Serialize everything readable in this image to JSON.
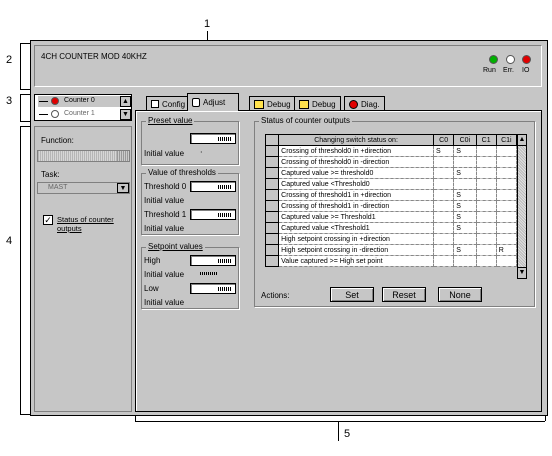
{
  "callouts": {
    "c1": "1",
    "c2": "2",
    "c3": "3",
    "c4": "4",
    "c5": "5"
  },
  "header": {
    "title": "4CH COUNTER MOD 40KHZ",
    "leds": [
      {
        "label": "Run",
        "color": "#00b000"
      },
      {
        "label": "Err.",
        "color": "#ffffff"
      },
      {
        "label": "IO",
        "color": "#e00000"
      }
    ]
  },
  "channels": [
    {
      "label": "Counter 0",
      "color": "#e00000"
    },
    {
      "label": "Counter 1",
      "color": "#ffffff"
    }
  ],
  "left": {
    "function_label": "Function:",
    "task_label": "Task:",
    "task_value": "MAST",
    "status_checkbox_label": "Status of counter outputs",
    "status_checked": true
  },
  "tabs": [
    {
      "label": "Config",
      "icon": "config-icon"
    },
    {
      "label": "Adjust",
      "icon": "adjust-icon"
    },
    {
      "label": "Debug",
      "icon": "debug-icon"
    },
    {
      "label": "Debug",
      "icon": "debug-icon"
    },
    {
      "label": "Diag.",
      "icon": "diag-icon"
    }
  ],
  "preset": {
    "title": "Preset value",
    "initial_label": "Initial value"
  },
  "thresholds": {
    "title": "Value of thresholds",
    "t0_label": "Threshold 0",
    "t1_label": "Threshold 1",
    "initial_label": "Initial value"
  },
  "setpoint": {
    "title": "Setpoint values",
    "high_label": "High",
    "low_label": "Low",
    "initial_label": "Initial value"
  },
  "outputs": {
    "title": "Status of counter outputs",
    "columns": [
      "Changing switch status on:",
      "C0",
      "C0i",
      "C1",
      "C1i"
    ],
    "rows": [
      {
        "label": "Crossing of threshold0 in +direction",
        "c0": "S",
        "c0i": "S",
        "c1": "",
        "c1i": ""
      },
      {
        "label": "Crossing of threshold0 in -direction",
        "c0": "",
        "c0i": "",
        "c1": "",
        "c1i": ""
      },
      {
        "label": "Captured value >= threshold0",
        "c0": "",
        "c0i": "S",
        "c1": "",
        "c1i": ""
      },
      {
        "label": "Captured value <Threshold0",
        "c0": "",
        "c0i": "",
        "c1": "",
        "c1i": ""
      },
      {
        "label": "Crossing of threshold1 in +direction",
        "c0": "",
        "c0i": "S",
        "c1": "",
        "c1i": ""
      },
      {
        "label": "Crossing of threshold1 in -direction",
        "c0": "",
        "c0i": "S",
        "c1": "",
        "c1i": ""
      },
      {
        "label": "Captured value >= Threshold1",
        "c0": "",
        "c0i": "S",
        "c1": "",
        "c1i": ""
      },
      {
        "label": "Captured value <Threshold1",
        "c0": "",
        "c0i": "S",
        "c1": "",
        "c1i": ""
      },
      {
        "label": "High setpoint crossing in +direction",
        "c0": "",
        "c0i": "",
        "c1": "",
        "c1i": ""
      },
      {
        "label": "High setpoint crossing in -direction",
        "c0": "",
        "c0i": "S",
        "c1": "",
        "c1i": "R"
      },
      {
        "label": "Value captured >= High set point",
        "c0": "",
        "c0i": "",
        "c1": "",
        "c1i": ""
      }
    ],
    "actions_label": "Actions:",
    "set_label": "Set",
    "reset_label": "Reset",
    "none_label": "None"
  }
}
